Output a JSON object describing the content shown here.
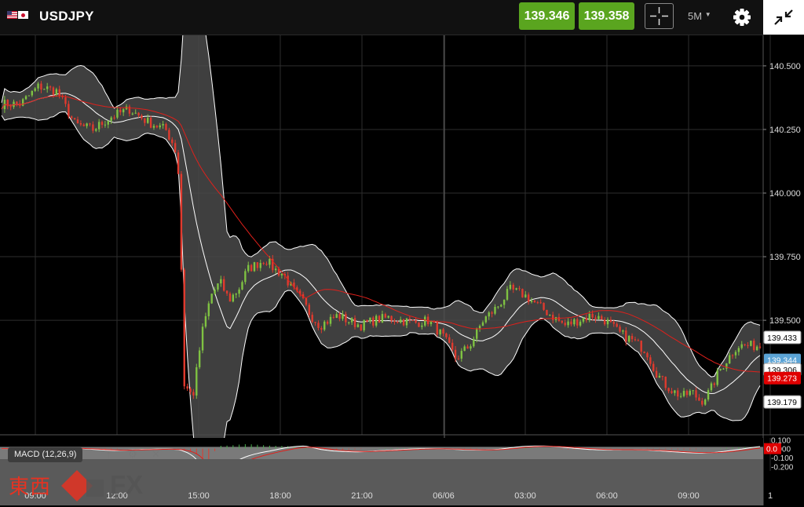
{
  "header": {
    "symbol": "USDJPY",
    "sell_price": "139.346",
    "buy_price": "139.358",
    "timeframe": "5M",
    "accent_green": "#5aa51f",
    "icons": [
      "us-flag-icon",
      "japan-flag-icon",
      "crosshair-icon",
      "dropdown-caret-icon",
      "gear-icon",
      "collapse-icon"
    ]
  },
  "macd": {
    "label": "MACD (12,26,9)",
    "tools": [
      "up-arrow-icon",
      "gear-icon",
      "close-icon"
    ],
    "ticks": [
      "0.100",
      "0.000",
      "-0.100",
      "-0.200"
    ],
    "current_value": "0.0"
  },
  "branding": {
    "logo_text": "東西",
    "logo_fx": "FX"
  },
  "chart_data": {
    "type": "candlestick",
    "symbol": "USDJPY",
    "timeframe": "5M",
    "x_ticks": [
      "09:00",
      "12:00",
      "15:00",
      "18:00",
      "21:00",
      "06/06",
      "03:00",
      "06:00",
      "09:00",
      "1"
    ],
    "y_ticks": [
      "140.500",
      "140.250",
      "140.000",
      "139.750",
      "139.500"
    ],
    "ylim": [
      139.05,
      140.62
    ],
    "overlays": [
      "Bollinger Bands",
      "Moving Average"
    ],
    "price_tags": [
      {
        "label": "139.433",
        "value": 139.433,
        "color": "#ffffff"
      },
      {
        "label": "139.344",
        "value": 139.344,
        "color": "#5ba4d6"
      },
      {
        "label": "139.306",
        "value": 139.306,
        "color": "#ffffff"
      },
      {
        "label": "139.273",
        "value": 139.273,
        "color": "#e00000"
      },
      {
        "label": "139.179",
        "value": 139.179,
        "color": "#ffffff"
      }
    ],
    "close_series": {
      "x": [
        "09:00",
        "09:40",
        "10:20",
        "11:00",
        "11:40",
        "12:20",
        "13:00",
        "13:40",
        "14:20",
        "14:40",
        "14:50",
        "15:00",
        "15:20",
        "15:40",
        "16:00",
        "16:20",
        "16:40",
        "17:00",
        "17:20",
        "17:40",
        "18:00",
        "18:20",
        "18:40",
        "19:00",
        "19:20",
        "19:40",
        "20:00",
        "20:20",
        "20:40",
        "21:00",
        "21:30",
        "22:00",
        "22:30",
        "23:00",
        "23:30",
        "00:00",
        "00:30",
        "01:00",
        "01:30",
        "02:00",
        "02:30",
        "03:00",
        "03:30",
        "04:00",
        "04:30",
        "05:00",
        "05:30",
        "06:00",
        "06:30",
        "07:00",
        "07:30",
        "08:00",
        "08:20",
        "08:40",
        "09:00",
        "09:20",
        "09:40",
        "10:00",
        "10:20",
        "10:40",
        "11:00",
        "11:20"
      ],
      "values": [
        140.35,
        140.42,
        140.4,
        140.27,
        140.25,
        140.3,
        140.33,
        140.28,
        140.25,
        140.18,
        140.05,
        139.25,
        139.2,
        139.45,
        139.6,
        139.65,
        139.58,
        139.62,
        139.7,
        139.72,
        139.74,
        139.7,
        139.68,
        139.62,
        139.58,
        139.52,
        139.48,
        139.5,
        139.52,
        139.5,
        139.48,
        139.5,
        139.51,
        139.5,
        139.49,
        139.5,
        139.44,
        139.35,
        139.4,
        139.5,
        139.55,
        139.62,
        139.6,
        139.56,
        139.52,
        139.48,
        139.5,
        139.52,
        139.5,
        139.45,
        139.42,
        139.38,
        139.3,
        139.25,
        139.22,
        139.2,
        139.22,
        139.18,
        139.22,
        139.3,
        139.35,
        139.4
      ]
    },
    "macd_ylim": [
      -0.25,
      0.12
    ]
  }
}
